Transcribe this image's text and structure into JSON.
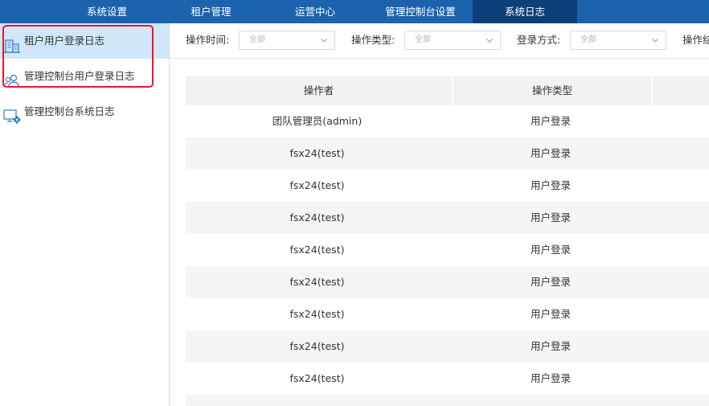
{
  "topnav": {
    "tabs": [
      {
        "label": "系统设置"
      },
      {
        "label": "租户管理"
      },
      {
        "label": "运营中心"
      },
      {
        "label": "管理控制台设置"
      },
      {
        "label": "系统日志"
      }
    ],
    "active_index": 4
  },
  "sidebar": {
    "items": [
      {
        "label": "租户用户登录日志",
        "icon": "building-icon"
      },
      {
        "label": "管理控制台用户登录日志",
        "icon": "users-icon"
      },
      {
        "label": "管理控制台系统日志",
        "icon": "monitor-gear-icon"
      }
    ],
    "active_index": 0
  },
  "filters": {
    "time": {
      "label": "操作时间:",
      "value": "全部"
    },
    "type": {
      "label": "操作类型:",
      "value": "全部"
    },
    "login_method": {
      "label": "登录方式:",
      "value": "全部"
    },
    "more": {
      "label": "操作结"
    }
  },
  "table": {
    "columns": [
      "操作者",
      "操作类型"
    ],
    "rows": [
      {
        "operator": "团队管理员(admin)",
        "action": "用户登录"
      },
      {
        "operator": "fsx24(test)",
        "action": "用户登录"
      },
      {
        "operator": "fsx24(test)",
        "action": "用户登录"
      },
      {
        "operator": "fsx24(test)",
        "action": "用户登录"
      },
      {
        "operator": "fsx24(test)",
        "action": "用户登录"
      },
      {
        "operator": "fsx24(test)",
        "action": "用户登录"
      },
      {
        "operator": "fsx24(test)",
        "action": "用户登录"
      },
      {
        "operator": "fsx24(test)",
        "action": "用户登录"
      },
      {
        "operator": "fsx24(test)",
        "action": "用户登录"
      }
    ]
  },
  "colors": {
    "nav_bg": "#1b63ad",
    "nav_active": "#0d3f78",
    "sidebar_active": "#cfe7f8",
    "highlight": "#e8162e",
    "icon_blue": "#2f7bc7"
  }
}
